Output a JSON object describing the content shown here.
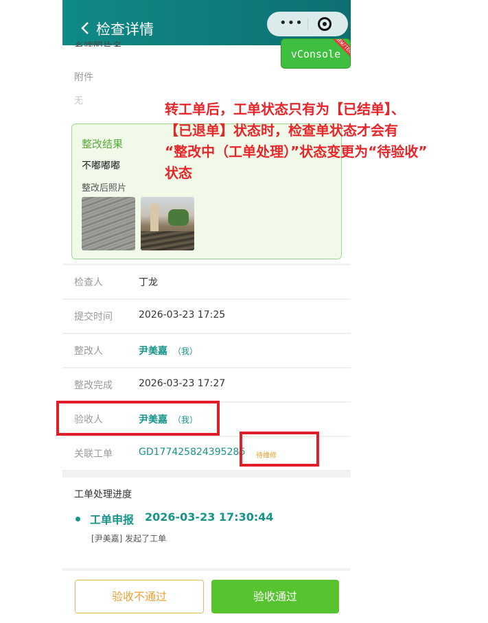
{
  "nav": {
    "title": "检查详情",
    "menu_dots": "•••"
  },
  "vconsole": {
    "label": "vConsole",
    "tag": "NEW/TEN"
  },
  "partial_line": "乡端照片名",
  "attachment": {
    "label": "附件",
    "value": "无"
  },
  "rectification": {
    "title": "整改结果",
    "text": "不嘟嘟嘟",
    "photos_label": "整改后照片"
  },
  "rows": {
    "inspector": {
      "label": "检查人",
      "value": "丁龙"
    },
    "submit_time": {
      "label": "提交时间",
      "value": "2026-03-23 17:25"
    },
    "rectifier": {
      "label": "整改人",
      "value": "尹美嘉",
      "me": "（我）"
    },
    "rectify_done": {
      "label": "整改完成",
      "value": "2026-03-23 17:27"
    },
    "acceptor": {
      "label": "验收人",
      "value": "尹美嘉",
      "me": "（我）"
    },
    "work_order": {
      "label": "关联工单",
      "value": "GD177425824395286",
      "chevron": "›",
      "status": "待维修"
    }
  },
  "progress": {
    "title": "工单处理进度",
    "item_type": "工单申报",
    "item_time": "2026-03-23 17:30:44",
    "item_desc": "[尹美嘉] 发起了工单"
  },
  "buttons": {
    "reject": "验收不通过",
    "pass": "验收通过"
  },
  "annotation": {
    "line1": "转工单后，工单状态只有为【已结单】、",
    "line2": "【已退单】状态时，检查单状态才会有",
    "line3": "“整改中（工单处理）”状态变更为“待验收”",
    "line4": "状态"
  },
  "colors": {
    "nav_bg": "#0f8a86",
    "accent": "#16958b",
    "pass_green": "#57c32f",
    "reject_orange": "#e9a23a",
    "annotation_red": "#e8262a"
  }
}
